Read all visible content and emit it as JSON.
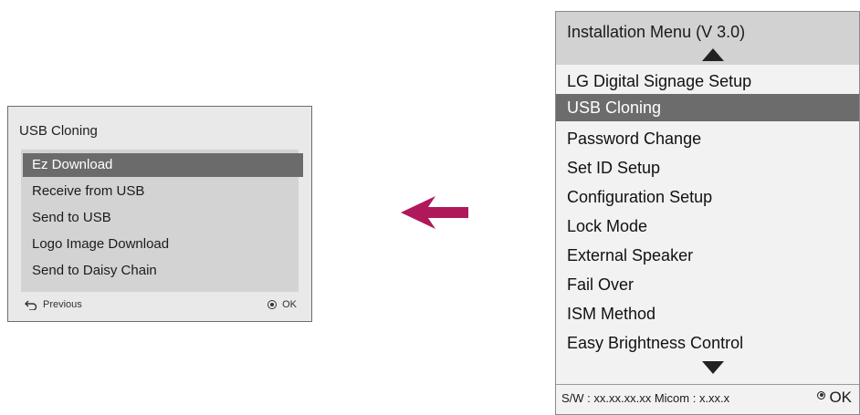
{
  "usb_cloning_dialog": {
    "title": "USB Cloning",
    "items": [
      {
        "label": "Ez Download",
        "selected": true
      },
      {
        "label": "Receive from USB",
        "selected": false
      },
      {
        "label": "Send to USB",
        "selected": false
      },
      {
        "label": "Logo Image Download",
        "selected": false
      },
      {
        "label": "Send to Daisy Chain",
        "selected": false
      }
    ],
    "footer": {
      "previous_label": "Previous",
      "ok_label": "OK"
    }
  },
  "arrow": {
    "icon": "arrow-left-icon",
    "color": "#b0185c"
  },
  "installation_menu": {
    "title": "Installation Menu (V 3.0)",
    "items": [
      {
        "label": "LG Digital Signage Setup",
        "selected": false
      },
      {
        "label": "USB Cloning",
        "selected": true
      },
      {
        "label": "Password Change",
        "selected": false
      },
      {
        "label": "Set ID Setup",
        "selected": false
      },
      {
        "label": "Configuration Setup",
        "selected": false
      },
      {
        "label": "Lock Mode",
        "selected": false
      },
      {
        "label": "External Speaker",
        "selected": false
      },
      {
        "label": "Fail Over",
        "selected": false
      },
      {
        "label": "ISM Method",
        "selected": false
      },
      {
        "label": "Easy Brightness Control",
        "selected": false
      }
    ],
    "status_text": "S/W : xx.xx.xx.xx Micom : x.xx.x",
    "ok_label": "OK"
  },
  "colors": {
    "selected_bg": "#6b6b6b",
    "panel_bg": "#d3d3d3",
    "arrow": "#b0185c"
  }
}
